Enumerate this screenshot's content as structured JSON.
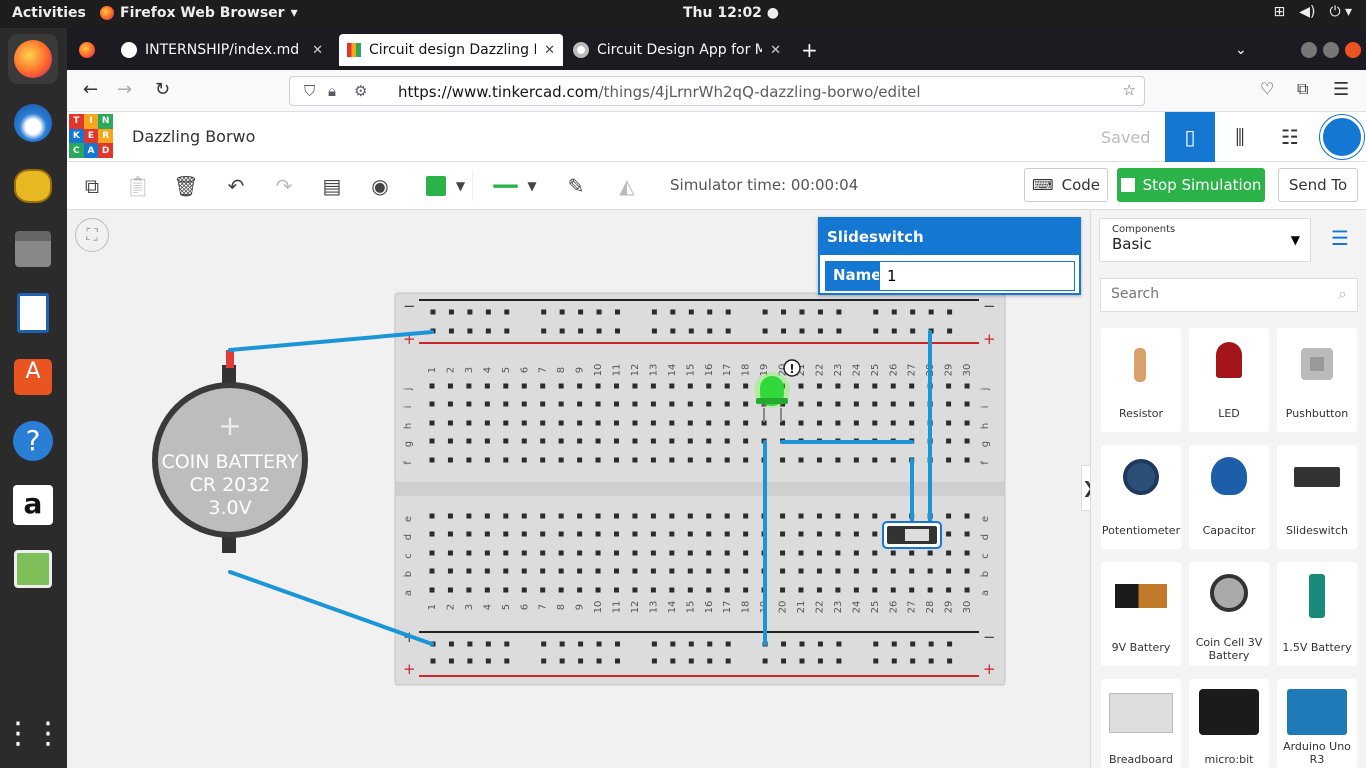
{
  "topbar": {
    "activities": "Activities",
    "app": "Firefox Web Browser",
    "clock": "Thu 12:02"
  },
  "tabs": [
    {
      "label": "INTERNSHIP/index.md at"
    },
    {
      "label": "Circuit design Dazzling Bo"
    },
    {
      "label": "Circuit Design App for Ma"
    }
  ],
  "browser": {
    "url_domain": "https://www.tinkercad.com",
    "url_path": "/things/4jLrnrWh2qQ-dazzling-borwo/editel"
  },
  "tinkercad": {
    "logo": [
      "T",
      "I",
      "N",
      "K",
      "E",
      "R",
      "C",
      "A",
      "D"
    ],
    "title": "Dazzling Borwo",
    "saved": "Saved"
  },
  "toolbar": {
    "simulator_time": "Simulator time: 00:00:04",
    "code_label": "Code",
    "stop_label": "Stop Simulation",
    "send_label": "Send To"
  },
  "inspector": {
    "title": "Slideswitch",
    "name_label": "Name",
    "name_value": "1"
  },
  "canvas": {
    "battery_lines": [
      "COIN BATTERY",
      "CR 2032",
      "3.0V"
    ],
    "warning": "!",
    "rows_top": [
      "j",
      "i",
      "h",
      "g",
      "f"
    ],
    "rows_bottom": [
      "e",
      "d",
      "c",
      "b",
      "a"
    ],
    "minus": "−",
    "plus": "+"
  },
  "components": {
    "heading": "Components",
    "category": "Basic",
    "search_placeholder": "Search",
    "items": [
      {
        "label": "Resistor"
      },
      {
        "label": "LED"
      },
      {
        "label": "Pushbutton"
      },
      {
        "label": "Potentiometer"
      },
      {
        "label": "Capacitor"
      },
      {
        "label": "Slideswitch"
      },
      {
        "label": "9V Battery"
      },
      {
        "label": "Coin Cell 3V Battery"
      },
      {
        "label": "1.5V Battery"
      },
      {
        "label": "Breadboard"
      },
      {
        "label": "micro:bit"
      },
      {
        "label": "Arduino Uno R3"
      }
    ]
  },
  "colors": {
    "accent": "#1477d2",
    "wire": "#1995d8",
    "sim_green": "#2bb34a"
  }
}
